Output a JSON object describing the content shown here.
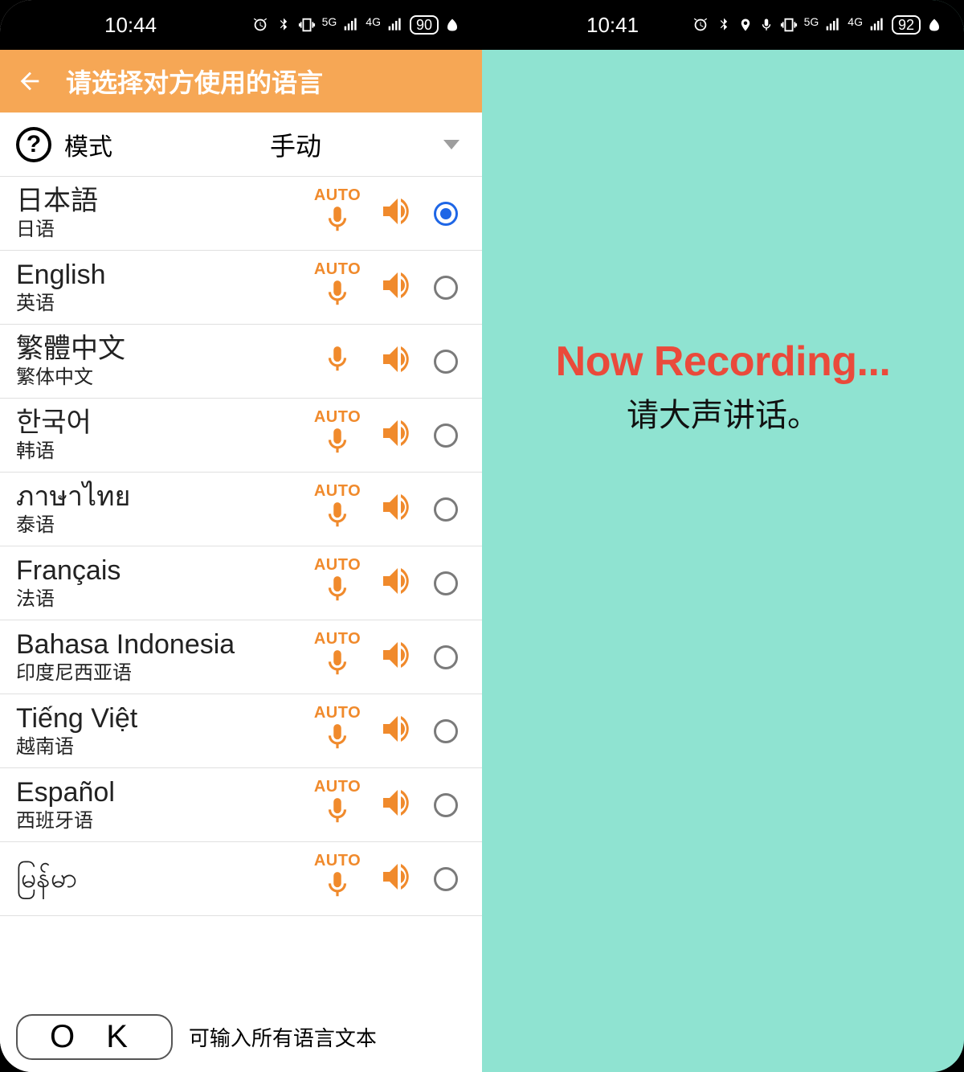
{
  "left": {
    "status": {
      "time": "10:44",
      "battery": "90"
    },
    "header": {
      "title": "请选择对方使用的语言"
    },
    "mode": {
      "label": "模式",
      "value": "手动"
    },
    "languages": [
      {
        "native": "日本語",
        "local": "日语",
        "auto": "AUTO",
        "selected": true
      },
      {
        "native": "English",
        "local": "英语",
        "auto": "AUTO",
        "selected": false
      },
      {
        "native": "繁體中文",
        "local": "繁体中文",
        "auto": "",
        "selected": false
      },
      {
        "native": "한국어",
        "local": "韩语",
        "auto": "AUTO",
        "selected": false
      },
      {
        "native": "ภาษาไทย",
        "local": "泰语",
        "auto": "AUTO",
        "selected": false
      },
      {
        "native": "Français",
        "local": "法语",
        "auto": "AUTO",
        "selected": false
      },
      {
        "native": "Bahasa Indonesia",
        "local": "印度尼西亚语",
        "auto": "AUTO",
        "selected": false
      },
      {
        "native": "Tiếng Việt",
        "local": "越南语",
        "auto": "AUTO",
        "selected": false
      },
      {
        "native": "Español",
        "local": "西班牙语",
        "auto": "AUTO",
        "selected": false
      },
      {
        "native": "မြန်မာ",
        "local": "",
        "auto": "AUTO",
        "selected": false
      }
    ],
    "bottom": {
      "ok": "O K",
      "hint": "可输入所有语言文本"
    }
  },
  "right": {
    "status": {
      "time": "10:41",
      "battery": "92"
    },
    "recording": {
      "title": "Now Recording...",
      "subtitle": "请大声讲话。"
    }
  }
}
